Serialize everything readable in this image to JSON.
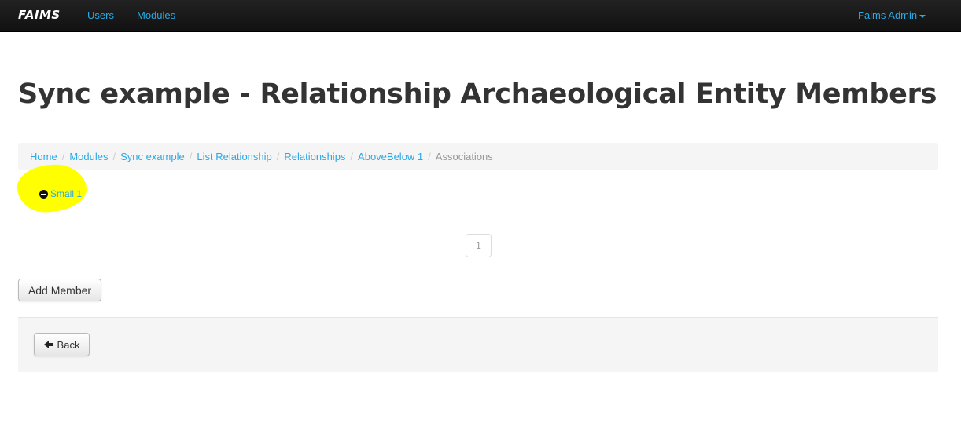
{
  "navbar": {
    "brand": "FAIMS",
    "links": [
      "Users",
      "Modules"
    ],
    "user_menu": "Faims Admin"
  },
  "page": {
    "title": "Sync example - Relationship Archaeological Entity Members"
  },
  "breadcrumb": {
    "items": [
      "Home",
      "Modules",
      "Sync example",
      "List Relationship",
      "Relationships",
      "AboveBelow 1"
    ],
    "active": "Associations",
    "separator": "/"
  },
  "members": [
    {
      "label": "Small 1",
      "highlighted": true,
      "highlight_color": "#ffff00"
    }
  ],
  "pagination": {
    "current_page": "1"
  },
  "actions": {
    "add_member_label": "Add Member",
    "back_label": "Back"
  },
  "colors": {
    "link": "#2aa9e6",
    "navbar_bg": "#1b1b1b",
    "title": "#333333"
  }
}
